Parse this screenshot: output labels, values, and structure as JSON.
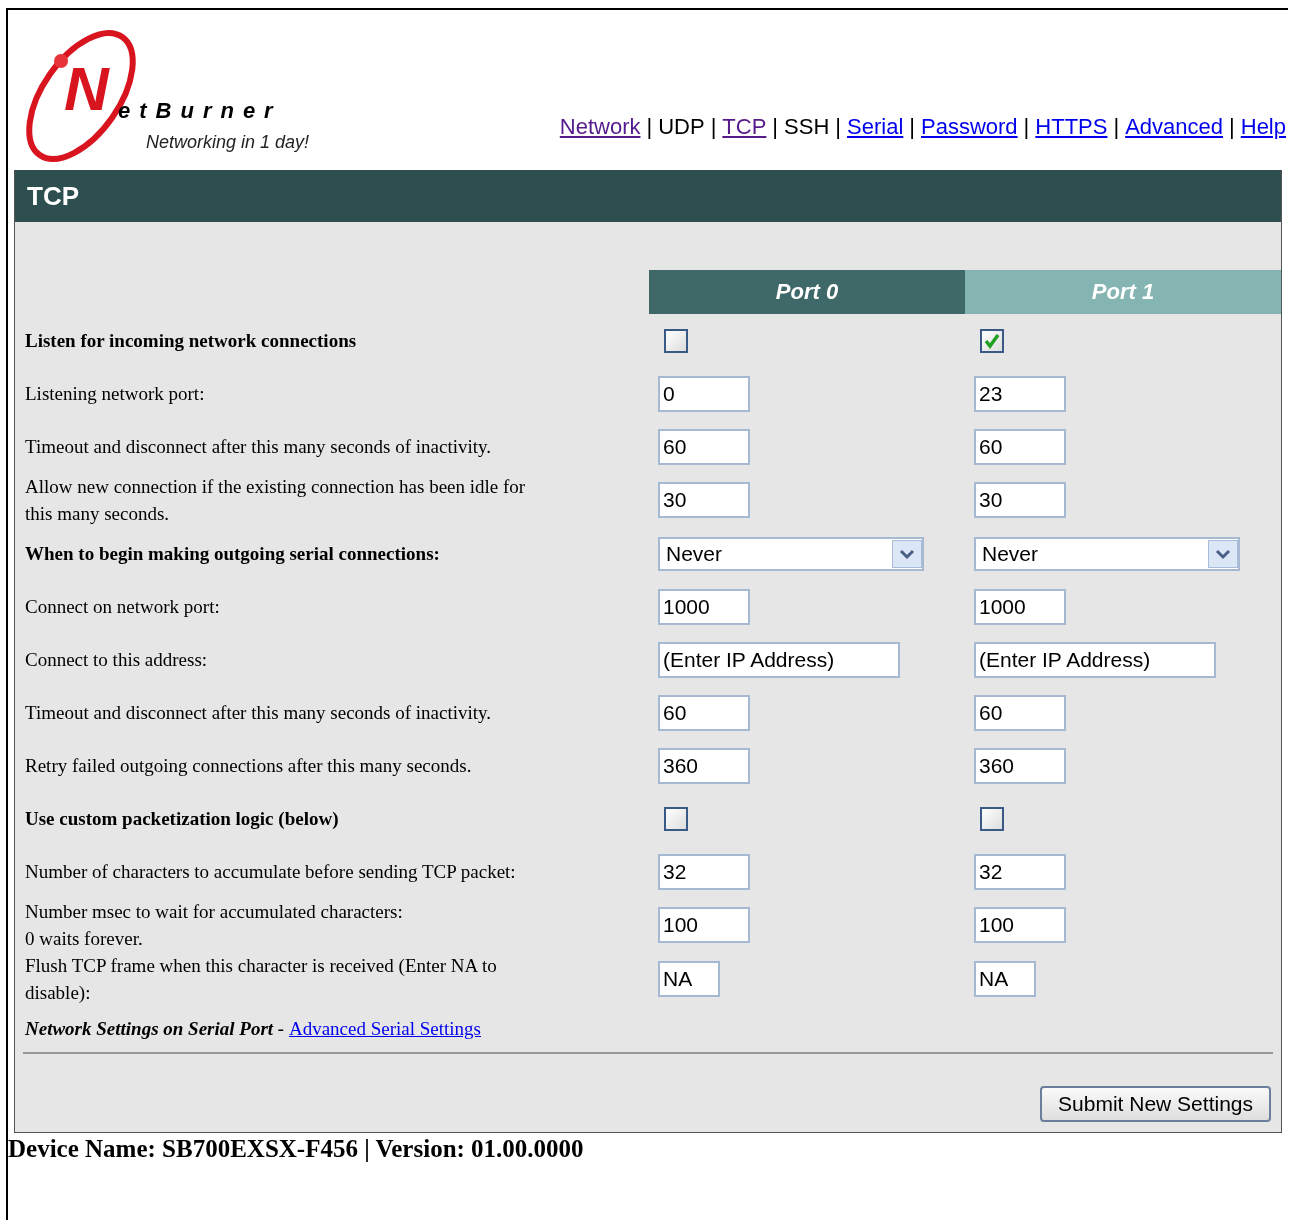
{
  "logo": {
    "initial": "N",
    "rest": "etBurner",
    "tagline": "Networking in 1 day!"
  },
  "nav_separator": "|",
  "nav": [
    {
      "label": "Network",
      "kind": "link",
      "color": "#551a8b"
    },
    {
      "label": "UDP",
      "kind": "plain",
      "color": "#000000"
    },
    {
      "label": "TCP",
      "kind": "link",
      "color": "#551a8b"
    },
    {
      "label": "SSH",
      "kind": "plain",
      "color": "#000000"
    },
    {
      "label": "Serial",
      "kind": "link",
      "color": "#0000ee"
    },
    {
      "label": "Password",
      "kind": "link",
      "color": "#0000ee"
    },
    {
      "label": "HTTPS",
      "kind": "link",
      "color": "#0000ee"
    },
    {
      "label": "Advanced",
      "kind": "link",
      "color": "#0000ee"
    },
    {
      "label": "Help",
      "kind": "link",
      "color": "#0000ee"
    }
  ],
  "panel_title": "TCP",
  "ports": [
    {
      "label": "Port 0",
      "selected": true
    },
    {
      "label": "Port 1",
      "selected": false
    }
  ],
  "rows": [
    {
      "label": "Listen for incoming network connections",
      "bold": true,
      "kind": "checkbox",
      "values": [
        {
          "checked": false
        },
        {
          "checked": true
        }
      ]
    },
    {
      "label": "Listening network port:",
      "bold": false,
      "kind": "text",
      "values": [
        {
          "value": "0"
        },
        {
          "value": "23"
        }
      ]
    },
    {
      "label": "Timeout and disconnect after this many seconds of inactivity.",
      "bold": false,
      "kind": "text",
      "values": [
        {
          "value": "60"
        },
        {
          "value": "60"
        }
      ]
    },
    {
      "label": "Allow new connection if the existing connection has been idle for this many seconds.",
      "bold": false,
      "kind": "text",
      "values": [
        {
          "value": "30"
        },
        {
          "value": "30"
        }
      ]
    },
    {
      "label": "When to begin making outgoing serial connections:",
      "bold": true,
      "kind": "select",
      "values": [
        {
          "value": "Never"
        },
        {
          "value": "Never"
        }
      ]
    },
    {
      "label": "Connect on network port:",
      "bold": false,
      "kind": "text",
      "values": [
        {
          "value": "1000"
        },
        {
          "value": "1000"
        }
      ]
    },
    {
      "label": "Connect to this address:",
      "bold": false,
      "kind": "address",
      "values": [
        {
          "value": "(Enter IP Address)"
        },
        {
          "value": "(Enter IP Address)"
        }
      ]
    },
    {
      "label": "Timeout and disconnect after this many seconds of inactivity.",
      "bold": false,
      "kind": "text",
      "values": [
        {
          "value": "60"
        },
        {
          "value": "60"
        }
      ]
    },
    {
      "label": "Retry failed outgoing connections after this many seconds.",
      "bold": false,
      "kind": "text",
      "values": [
        {
          "value": "360"
        },
        {
          "value": "360"
        }
      ]
    },
    {
      "label": "Use custom packetization logic (below)",
      "bold": true,
      "kind": "checkbox",
      "values": [
        {
          "checked": false
        },
        {
          "checked": false
        }
      ]
    },
    {
      "label": "Number of characters to accumulate before sending TCP packet:",
      "bold": false,
      "kind": "text",
      "values": [
        {
          "value": "32"
        },
        {
          "value": "32"
        }
      ]
    },
    {
      "label": "Number msec to wait for accumulated characters:\n0 waits forever.",
      "bold": false,
      "kind": "text",
      "values": [
        {
          "value": "100"
        },
        {
          "value": "100"
        }
      ]
    },
    {
      "label": "Flush TCP frame when this character is received (Enter NA to disable):",
      "bold": false,
      "kind": "char",
      "values": [
        {
          "value": "NA"
        },
        {
          "value": "NA"
        }
      ]
    }
  ],
  "note": {
    "text": "Network Settings on Serial Port - ",
    "link": "Advanced Serial Settings"
  },
  "submit": "Submit New Settings",
  "footer": "Device Name: SB700EXSX-F456 | Version: 01.00.0000"
}
